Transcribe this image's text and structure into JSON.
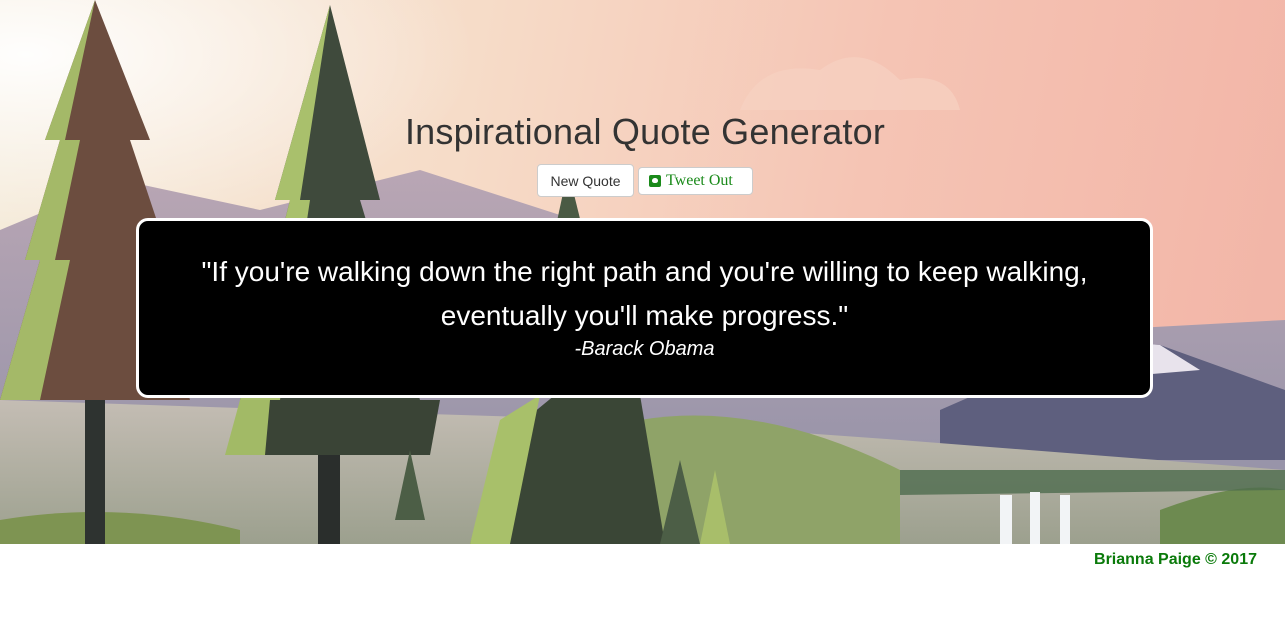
{
  "header": {
    "title": "Inspirational Quote Generator"
  },
  "buttons": {
    "new_quote": "New Quote",
    "tweet_out": "Tweet Out",
    "tweet_icon": "twitter-icon"
  },
  "quote": {
    "text": "\"If you're walking down the right path and you're willing to keep walking, eventually you'll make progress.\"",
    "author": "-Barack Obama"
  },
  "footer": {
    "credit": "Brianna Paige © 2017"
  },
  "colors": {
    "accent_green": "#0a7a0a",
    "quote_bg": "#000000",
    "sky_pink": "#f2b4a6"
  }
}
